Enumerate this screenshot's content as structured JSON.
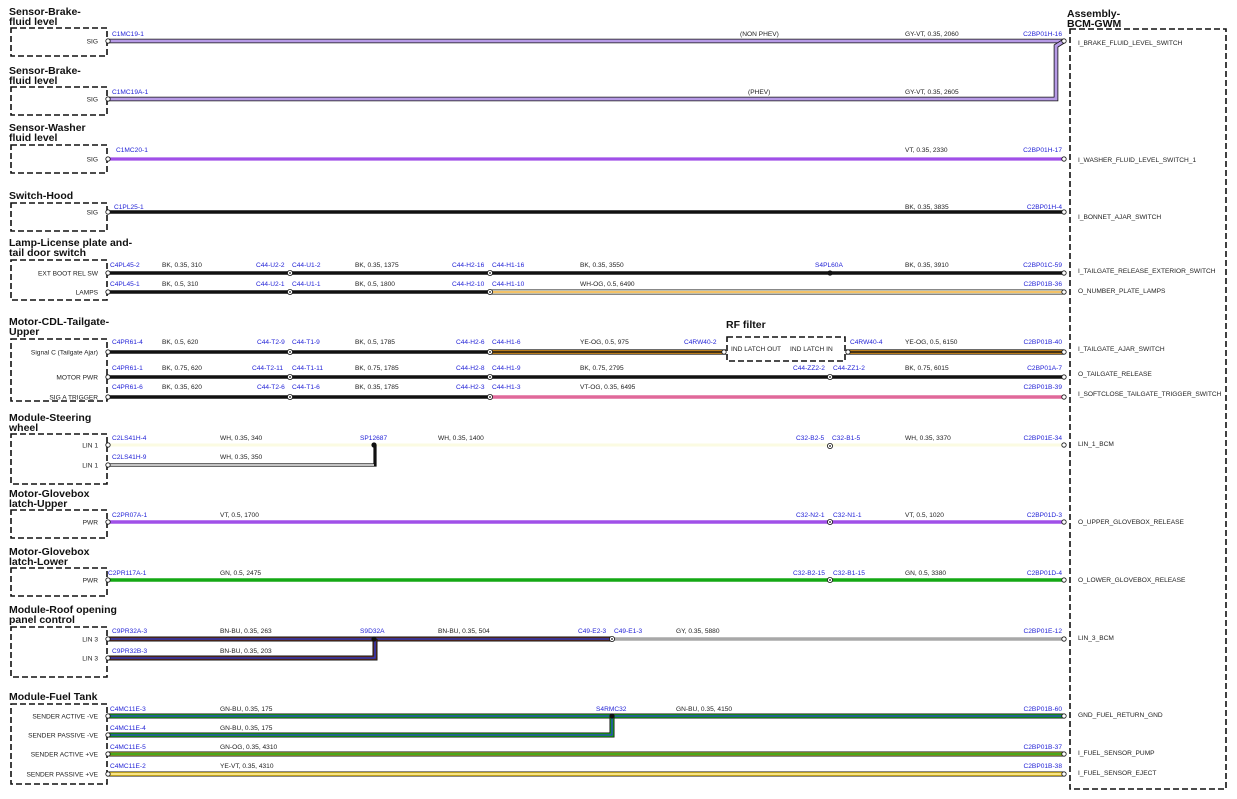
{
  "right_module": {
    "title_line1": "Assembly-",
    "title_line2": "BCM-GWM"
  },
  "rf_filter": {
    "title": "RF filter",
    "pin_out": "IND LATCH OUT",
    "pin_in": "IND LATCH IN"
  },
  "blocks": [
    {
      "id": "b1",
      "title": [
        "Sensor-Brake-",
        "fluid level"
      ],
      "pins": [
        "SIG"
      ]
    },
    {
      "id": "b2",
      "title": [
        "Sensor-Brake-",
        "fluid level"
      ],
      "pins": [
        "SIG"
      ]
    },
    {
      "id": "b3",
      "title": [
        "Sensor-Washer",
        "fluid level"
      ],
      "pins": [
        "SIG"
      ]
    },
    {
      "id": "b4",
      "title": [
        "Switch-Hood"
      ],
      "pins": [
        "SIG"
      ]
    },
    {
      "id": "b5",
      "title": [
        "Lamp-License plate and-",
        "tail door switch"
      ],
      "pins": [
        "EXT BOOT REL SW",
        "LAMPS"
      ]
    },
    {
      "id": "b6",
      "title": [
        "Motor-CDL-Tailgate-",
        "Upper"
      ],
      "pins": [
        "Signal C (Tailgate Ajar)",
        "MOTOR PWR",
        "SIG A TRIGGER"
      ]
    },
    {
      "id": "b7",
      "title": [
        "Module-Steering",
        "wheel"
      ],
      "pins": [
        "LIN 1",
        "LIN 1"
      ]
    },
    {
      "id": "b8",
      "title": [
        "Motor-Glovebox",
        "latch-Upper"
      ],
      "pins": [
        "PWR"
      ]
    },
    {
      "id": "b9",
      "title": [
        "Motor-Glovebox",
        "latch-Lower"
      ],
      "pins": [
        "PWR"
      ]
    },
    {
      "id": "b10",
      "title": [
        "Module-Roof opening",
        "panel control"
      ],
      "pins": [
        "LIN 3",
        "LIN 3"
      ]
    },
    {
      "id": "b11",
      "title": [
        "Module-Fuel Tank"
      ],
      "pins": [
        "SENDER ACTIVE -VE",
        "SENDER PASSIVE -VE",
        "SENDER ACTIVE +VE",
        "SENDER PASSIVE +VE"
      ]
    }
  ],
  "connectors": [
    "C1MC19-1",
    "C2BP01H-16",
    "C1MC19A-1",
    "C1MC20-1",
    "C2BP01H-17",
    "C1PL25-1",
    "C2BP01H-4",
    "C4PL45-2",
    "C44-U2-2",
    "C44-U1-2",
    "C44-H2-16",
    "C44-H1-16",
    "S4PL60A",
    "C2BP01C-59",
    "C4PL45-1",
    "C44-U2-1",
    "C44-U1-1",
    "C44-H2-10",
    "C44-H1-10",
    "C2BP01B-36",
    "C4PR61-4",
    "C44-T2-9",
    "C44-T1-9",
    "C44-H2-6",
    "C44-H1-6",
    "C4RW40-2",
    "C4RW40-4",
    "C2BP01B-40",
    "C4PR61-1",
    "C44-T2-11",
    "C44-T1-11",
    "C44-H2-8",
    "C44-H1-9",
    "C44-ZZ2-2",
    "C44-ZZ1-2",
    "C2BP01A-7",
    "C4PR61-6",
    "C44-T2-6",
    "C44-T1-6",
    "C44-H2-3",
    "C44-H1-3",
    "C2BP01B-39",
    "C2LS41H-4",
    "SP12687",
    "C32-B2-5",
    "C32-B1-5",
    "C2BP01E-34",
    "C2LS41H-9",
    "C2PR07A-1",
    "C32-N2-1",
    "C32-N1-1",
    "C2BP01D-3",
    "C2PR117A-1",
    "C32-B2-15",
    "C32-B1-15",
    "C2BP01D-4",
    "C9PR32A-3",
    "S9D32A",
    "C49-E2-3",
    "C49-E1-3",
    "C2BP01E-12",
    "C9PR32B-3",
    "C4MC11E-3",
    "S4RMC32",
    "C2BP01B-60",
    "C4MC11E-4",
    "C4MC11E-5",
    "C2BP01B-37",
    "C4MC11E-2",
    "C2BP01B-38"
  ],
  "wire_specs": [
    "(NON PHEV)",
    "GY-VT,  0.35,  2060",
    "(PHEV)",
    "GY-VT,  0.35,  2605",
    "VT,  0.35,  2330",
    "BK,  0.35,  3835",
    "BK,  0.35,  310",
    "BK,  0.35,  1375",
    "BK,  0.35,  3550",
    "BK,  0.35,  3910",
    "BK,  0.5,  310",
    "BK,  0.5,  1800",
    "WH-OG,  0.5,  6490",
    "BK,  0.5,  620",
    "BK,  0.5,  1785",
    "YE-OG,  0.5,  975",
    "YE-OG,  0.5,  6150",
    "BK,  0.75,  620",
    "BK,  0.75,  1785",
    "BK,  0.75,  2795",
    "BK,  0.75,  6015",
    "BK,  0.35,  620",
    "BK,  0.35,  1785",
    "VT-OG,  0.35,  6495",
    "WH,  0.35,  340",
    "WH,  0.35,  1400",
    "WH,  0.35,  3370",
    "WH,  0.35,  350",
    "VT,  0.5,  1700",
    "VT,  0.5,  1020",
    "GN,  0.5,  2475",
    "GN,  0.5,  3380",
    "BN-BU,  0.35,  263",
    "BN-BU,  0.35,  504",
    "GY,  0.35,  5880",
    "BN-BU,  0.35,  203",
    "GN-BU,  0.35,  175",
    "GN-BU,  0.35,  4150",
    "GN-BU,  0.35,  175",
    "GN-OG,  0.35,  4310",
    "YE-VT,  0.35,  4310"
  ],
  "bcm_signals": [
    "I_BRAKE_FLUID_LEVEL_SWITCH",
    "I_WASHER_FLUID_LEVEL_SWITCH_1",
    "I_BONNET_AJAR_SWITCH",
    "I_TAILGATE_RELEASE_EXTERIOR_SWITCH",
    "O_NUMBER_PLATE_LAMPS",
    "I_TAILGATE_AJAR_SWITCH",
    "O_TAILGATE_RELEASE",
    "I_SOFTCLOSE_TAILGATE_TRIGGER_SWITCH",
    "LIN_1_BCM",
    "O_UPPER_GLOVEBOX_RELEASE",
    "O_LOWER_GLOVEBOX_RELEASE",
    "LIN_3_BCM",
    "GND_FUEL_RETURN_GND",
    "I_FUEL_SENSOR_PUMP",
    "I_FUEL_SENSOR_EJECT"
  ],
  "colors": {
    "violet": "#a050e8",
    "violet_light": "#b79be6",
    "black": "#111111",
    "orange": "#f0a020",
    "pink": "#e0689a",
    "cream": "#fbfbe2",
    "green": "#14a814",
    "gray": "#a8a8a8",
    "brown": "#5a2a1a",
    "blue": "#2a3ad8",
    "yellow_green": "#a0a828",
    "yellow": "#f8d020"
  }
}
